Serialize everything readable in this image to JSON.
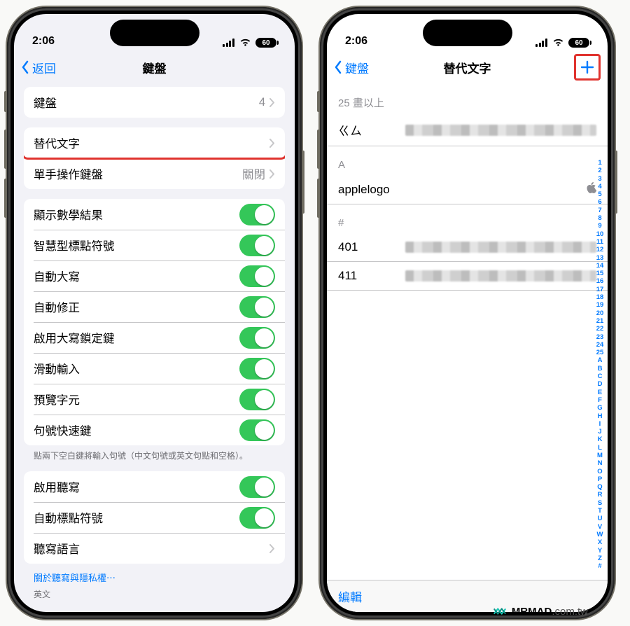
{
  "status": {
    "time": "2:06",
    "battery": "60"
  },
  "left": {
    "back": "返回",
    "title": "鍵盤",
    "rows": {
      "keyboards": {
        "label": "鍵盤",
        "value": "4"
      },
      "text_replace": {
        "label": "替代文字"
      },
      "one_hand": {
        "label": "單手操作鍵盤",
        "value": "關閉"
      }
    },
    "toggles": [
      {
        "label": "顯示數學結果"
      },
      {
        "label": "智慧型標點符號"
      },
      {
        "label": "自動大寫"
      },
      {
        "label": "自動修正"
      },
      {
        "label": "啟用大寫鎖定鍵"
      },
      {
        "label": "滑動輸入"
      },
      {
        "label": "預覽字元"
      },
      {
        "label": "句號快速鍵"
      }
    ],
    "toggles_footer": "點兩下空白鍵將輸入句號（中文句號或英文句點和空格）。",
    "dictation": {
      "enable": "啟用聽寫",
      "auto_punct": "自動標點符號",
      "lang": "聽寫語言"
    },
    "privacy_link": "關於聽寫與隱私權⋯",
    "lang_footer": "英文"
  },
  "right": {
    "back": "鍵盤",
    "title": "替代文字",
    "sections": {
      "s25": "25 畫以上",
      "sA": "A",
      "sHash": "#"
    },
    "items": {
      "gm": "ㄍㄙ",
      "applelogo": "applelogo",
      "i401": "401",
      "i411": "411"
    },
    "edit": "編輯",
    "index": [
      "1",
      "2",
      "3",
      "4",
      "5",
      "6",
      "7",
      "8",
      "9",
      "10",
      "11",
      "12",
      "13",
      "14",
      "15",
      "16",
      "17",
      "18",
      "19",
      "20",
      "21",
      "22",
      "23",
      "24",
      "25",
      "A",
      "B",
      "C",
      "D",
      "E",
      "F",
      "G",
      "H",
      "I",
      "J",
      "K",
      "L",
      "M",
      "N",
      "O",
      "P",
      "Q",
      "R",
      "S",
      "T",
      "U",
      "V",
      "W",
      "X",
      "Y",
      "Z",
      "#"
    ]
  },
  "watermark": {
    "brand": "MRMAD",
    "suffix": ".com.tw"
  }
}
